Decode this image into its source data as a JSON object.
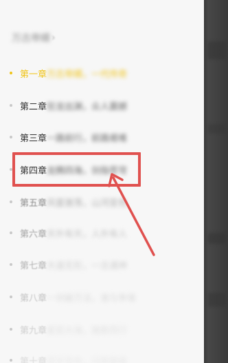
{
  "drawer": {
    "book_title": "万古帝婿",
    "chapters": [
      {
        "number": "第一章",
        "title": "万古帝婿，一代传奇",
        "state": "active"
      },
      {
        "number": "第二章",
        "title": "狂龙出渊，众人震撼",
        "state": "normal"
      },
      {
        "number": "第三章",
        "title": "一路前行，前路艰难",
        "state": "normal"
      },
      {
        "number": "第四章",
        "title": "龙腾四海，剑指苍穹",
        "state": "normal"
      },
      {
        "number": "第五章",
        "title": "风雷激荡，山河变色",
        "state": "fade1"
      },
      {
        "number": "第六章",
        "title": "天外有天，人外有人",
        "state": "fade2"
      },
      {
        "number": "第七章",
        "title": "大道无形，一念通神",
        "state": "fade3"
      },
      {
        "number": "第八章",
        "title": "一剑破万法，谁与争锋",
        "state": "fade4"
      },
      {
        "number": "第九章",
        "title": "星辰大海，踏歌而行",
        "state": "fade5"
      },
      {
        "number": "第十章",
        "title": "逆天改命，问鼎巅峰",
        "state": "fade6"
      }
    ]
  },
  "annotation": {
    "box_color": "#e0514f",
    "arrow_color": "#e0514f"
  },
  "colors": {
    "accent_active": "#f0c419",
    "drawer_bg": "#f7f7f7",
    "overlay_bg": "#3c3c3c"
  }
}
